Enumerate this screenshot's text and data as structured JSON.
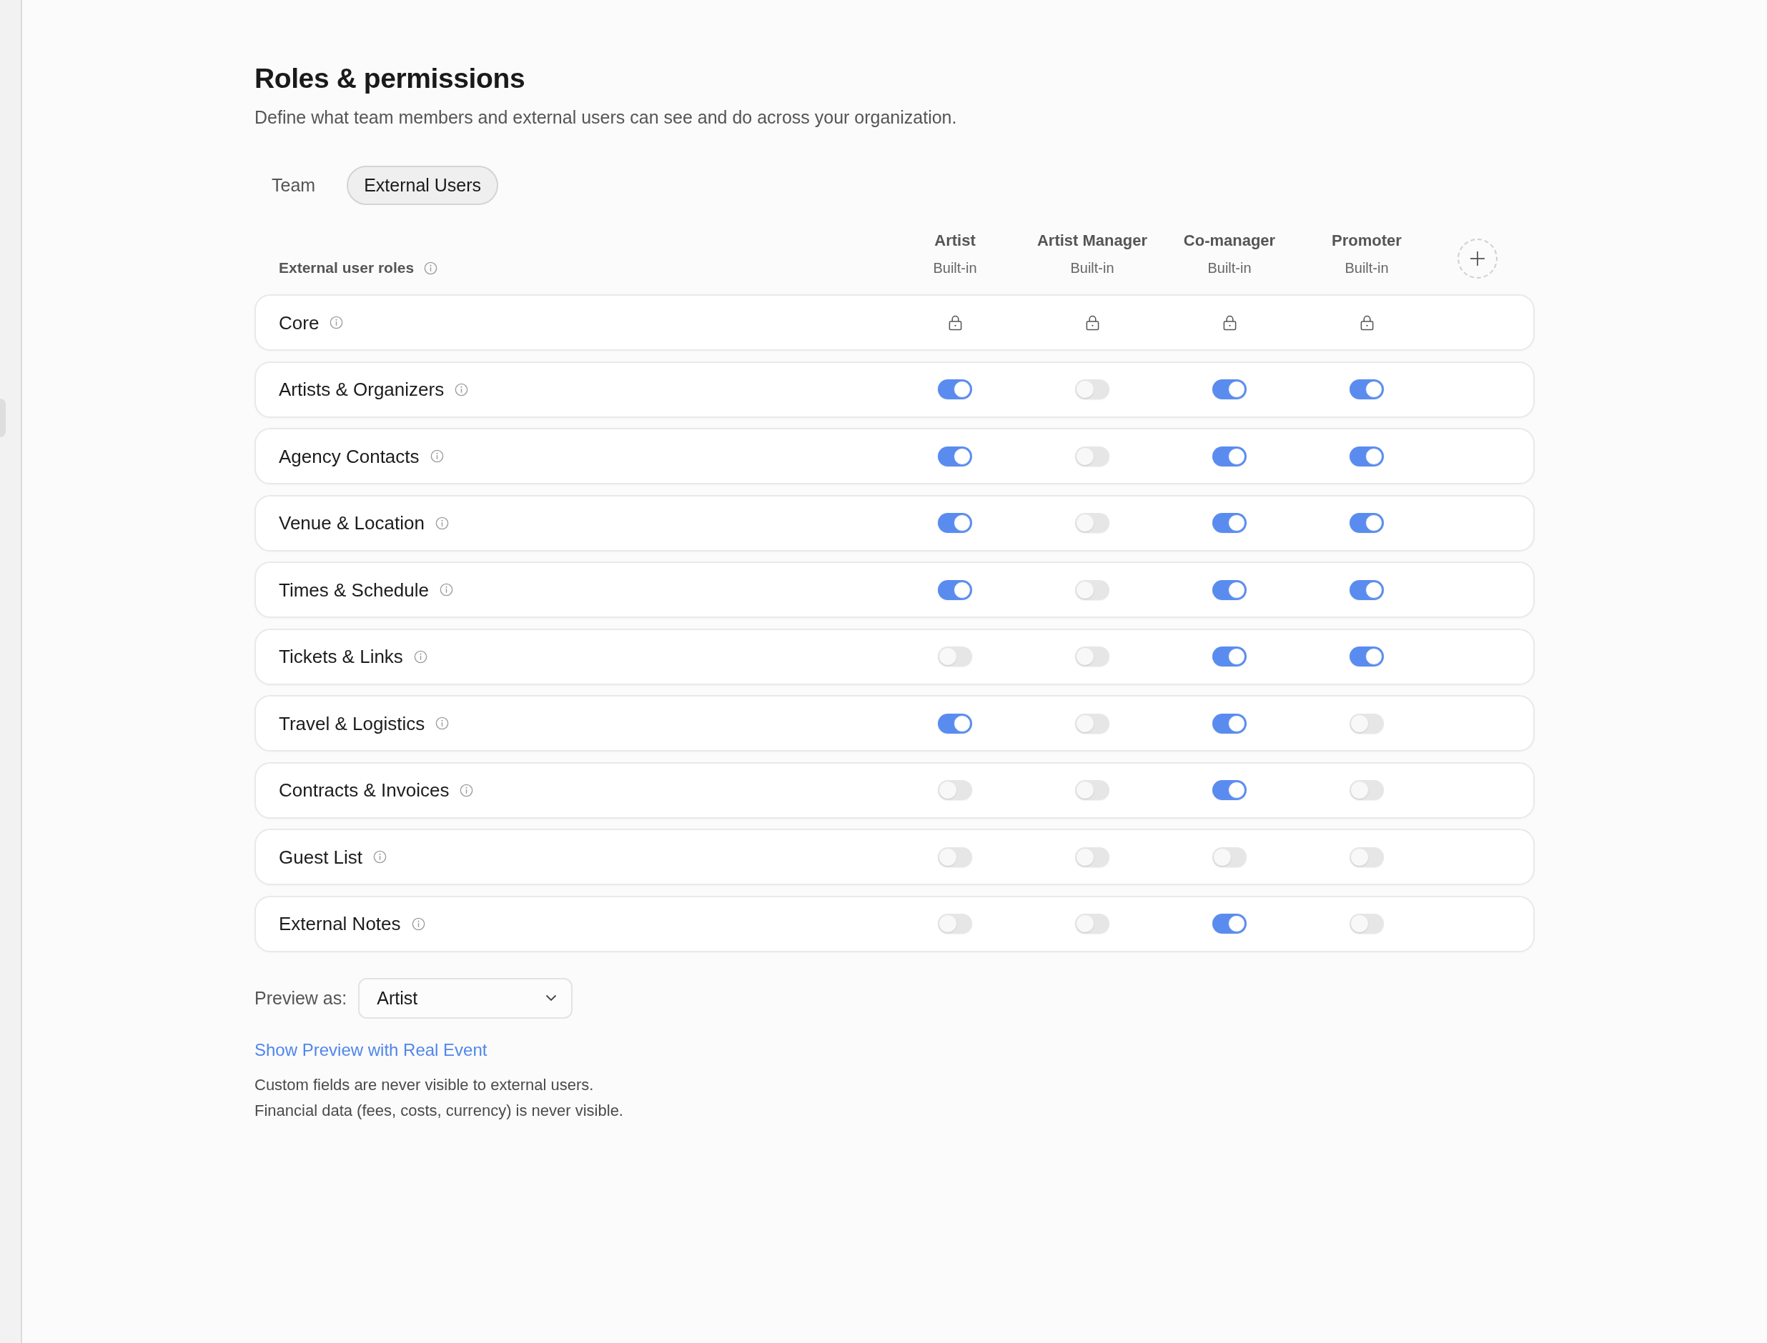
{
  "header": {
    "title": "Roles & permissions",
    "description": "Define what team members and external users can see and do across your organization."
  },
  "tabs": [
    {
      "label": "Team",
      "selected": false
    },
    {
      "label": "External Users",
      "selected": true
    }
  ],
  "roles_table": {
    "heading": "External user roles",
    "columns": [
      {
        "name": "Artist",
        "subtitle": "Built-in"
      },
      {
        "name": "Artist Manager",
        "subtitle": "Built-in"
      },
      {
        "name": "Co-manager",
        "subtitle": "Built-in"
      },
      {
        "name": "Promoter",
        "subtitle": "Built-in"
      }
    ],
    "rows": [
      {
        "label": "Core",
        "cells": [
          {
            "kind": "lock"
          },
          {
            "kind": "lock"
          },
          {
            "kind": "lock"
          },
          {
            "kind": "lock"
          }
        ]
      },
      {
        "label": "Artists & Organizers",
        "cells": [
          {
            "kind": "toggle",
            "on": true
          },
          {
            "kind": "toggle",
            "on": false
          },
          {
            "kind": "toggle",
            "on": true
          },
          {
            "kind": "toggle",
            "on": true
          }
        ]
      },
      {
        "label": "Agency Contacts",
        "cells": [
          {
            "kind": "toggle",
            "on": true
          },
          {
            "kind": "toggle",
            "on": false
          },
          {
            "kind": "toggle",
            "on": true
          },
          {
            "kind": "toggle",
            "on": true
          }
        ]
      },
      {
        "label": "Venue & Location",
        "cells": [
          {
            "kind": "toggle",
            "on": true
          },
          {
            "kind": "toggle",
            "on": false
          },
          {
            "kind": "toggle",
            "on": true
          },
          {
            "kind": "toggle",
            "on": true
          }
        ]
      },
      {
        "label": "Times & Schedule",
        "cells": [
          {
            "kind": "toggle",
            "on": true
          },
          {
            "kind": "toggle",
            "on": false
          },
          {
            "kind": "toggle",
            "on": true
          },
          {
            "kind": "toggle",
            "on": true
          }
        ]
      },
      {
        "label": "Tickets & Links",
        "cells": [
          {
            "kind": "toggle",
            "on": false
          },
          {
            "kind": "toggle",
            "on": false
          },
          {
            "kind": "toggle",
            "on": true
          },
          {
            "kind": "toggle",
            "on": true
          }
        ]
      },
      {
        "label": "Travel & Logistics",
        "cells": [
          {
            "kind": "toggle",
            "on": true
          },
          {
            "kind": "toggle",
            "on": false
          },
          {
            "kind": "toggle",
            "on": true
          },
          {
            "kind": "toggle",
            "on": false
          }
        ]
      },
      {
        "label": "Contracts & Invoices",
        "cells": [
          {
            "kind": "toggle",
            "on": false
          },
          {
            "kind": "toggle",
            "on": false
          },
          {
            "kind": "toggle",
            "on": true
          },
          {
            "kind": "toggle",
            "on": false
          }
        ]
      },
      {
        "label": "Guest List",
        "cells": [
          {
            "kind": "toggle",
            "on": false
          },
          {
            "kind": "toggle",
            "on": false
          },
          {
            "kind": "toggle",
            "on": false
          },
          {
            "kind": "toggle",
            "on": false
          }
        ]
      },
      {
        "label": "External Notes",
        "cells": [
          {
            "kind": "toggle",
            "on": false
          },
          {
            "kind": "toggle",
            "on": false
          },
          {
            "kind": "toggle",
            "on": true
          },
          {
            "kind": "toggle",
            "on": false
          }
        ]
      }
    ]
  },
  "preview": {
    "label": "Preview as:",
    "value": "Artist"
  },
  "link": "Show Preview with Real Event",
  "notes": [
    "Custom fields are never visible to external users.",
    "Financial data (fees, costs, currency) is never visible."
  ]
}
